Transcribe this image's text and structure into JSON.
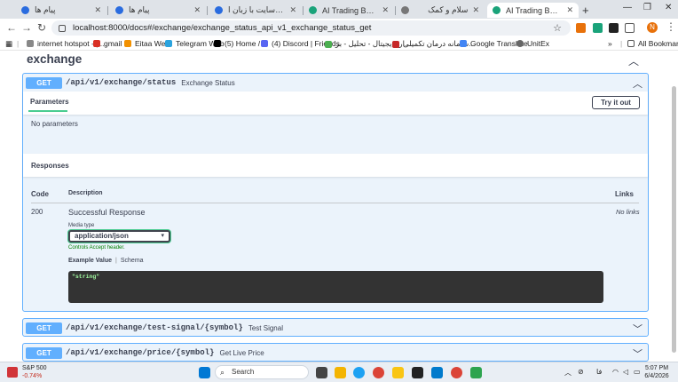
{
  "browser": {
    "tabs": [
      {
        "title": "پیام ها",
        "active": false
      },
      {
        "title": "پیام ها",
        "active": false
      },
      {
        "title": "پروژه طراحی سایت با زبان ا...",
        "active": false
      },
      {
        "title": "AI Trading Bot - Swagger U",
        "active": false
      },
      {
        "title": "سلام و کمک",
        "active": false
      },
      {
        "title": "AI Trading Bot - Swagger U",
        "active": true
      }
    ],
    "new_tab": "+",
    "url": "localhost:8000/docs#/exchange/exchange_status_api_v1_exchange_status_get",
    "profile_initial": "N",
    "bookmarks": [
      "internet hotspot - |...",
      "gmail",
      "Eitaa Web",
      "Telegram Web",
      "(5) Home / X",
      "(4) Discord | Friends",
      "ارزدیجیتال - تحلیل - بر...",
      "سامانه درمان تکمیلی...",
      "Google Translate",
      "UnitEx"
    ],
    "all_bookmarks": "All Bookmarks"
  },
  "swagger": {
    "section_title": "exchange",
    "operations": [
      {
        "method": "GET",
        "path": "/api/v1/exchange/status",
        "summary": "Exchange Status"
      },
      {
        "method": "GET",
        "path": "/api/v1/exchange/test-signal/{symbol}",
        "summary": "Test Signal"
      },
      {
        "method": "GET",
        "path": "/api/v1/exchange/price/{symbol}",
        "summary": "Get Live Price"
      }
    ],
    "parameters_tab": "Parameters",
    "try_it_out": "Try it out",
    "no_parameters": "No parameters",
    "responses_title": "Responses",
    "col_code": "Code",
    "col_description": "Description",
    "col_links": "Links",
    "response": {
      "code": "200",
      "description": "Successful Response",
      "links": "No links",
      "media_type_label": "Media type",
      "media_type": "application/json",
      "controls_header": "Controls Accept header.",
      "example_value_tab": "Example Value",
      "schema_tab": "Schema",
      "example": "\"string\""
    }
  },
  "taskbar": {
    "stock_name": "S&P 500",
    "stock_change": "-0.74%",
    "search_placeholder": "Search",
    "lang": "فا",
    "time": "5:07 PM",
    "date": "6/4/2026"
  }
}
